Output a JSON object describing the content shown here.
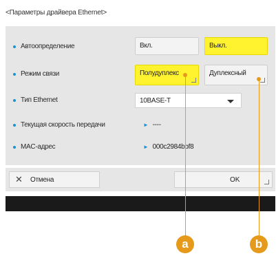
{
  "title": "<Параметры драйвера Ethernet>",
  "rows": {
    "auto": {
      "label": "Автоопределение",
      "on": "Вкл.",
      "off": "Выкл."
    },
    "mode": {
      "label": "Режим связи",
      "half": "Полудуплекс",
      "full": "Дуплексный"
    },
    "type": {
      "label": "Тип Ethernet",
      "value": "10BASE-T"
    },
    "speed": {
      "label": "Текущая скорость передачи",
      "value": "----"
    },
    "mac": {
      "label": "MAC-адрес",
      "value": "000c2984bbf8"
    }
  },
  "buttons": {
    "cancel": "Отмена",
    "ok": "OK"
  },
  "callouts": {
    "a": "a",
    "b": "b"
  },
  "colors": {
    "selected": "#fff22e",
    "accent": "#1e90d4",
    "callout": "#e59a1c"
  }
}
